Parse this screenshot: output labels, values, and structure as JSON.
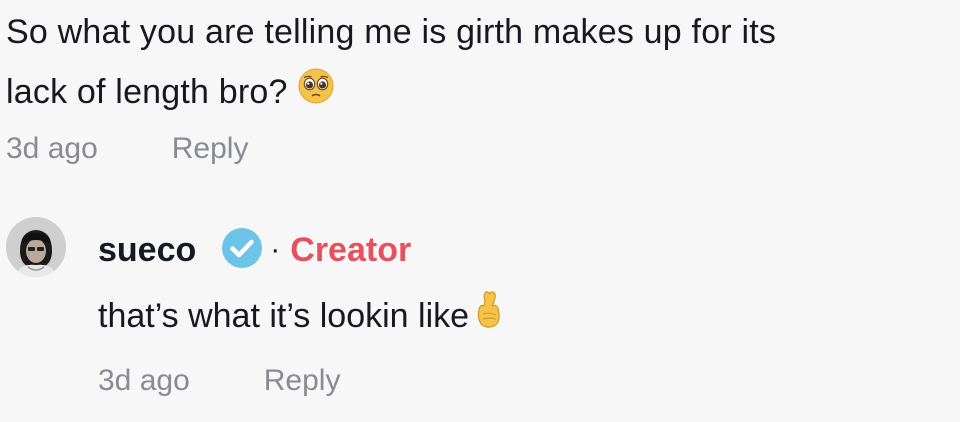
{
  "parent_comment": {
    "text_line1": "So what you are telling me is girth makes up for its",
    "text_line2": "lack of length bro?",
    "emoji": "pleading-face-icon",
    "time": "3d ago",
    "reply_label": "Reply"
  },
  "reply_comment": {
    "username": "sueco",
    "verified_icon": "verified-check-icon",
    "separator": "·",
    "badge": "Creator",
    "text": "that’s what it’s lookin like",
    "emoji": "crossed-fingers-icon",
    "time": "3d ago",
    "reply_label": "Reply"
  },
  "colors": {
    "creator_badge": "#e8505f",
    "verified": "#6ec4e8",
    "meta_text": "#8a8b91",
    "background": "#f7f7f8"
  }
}
